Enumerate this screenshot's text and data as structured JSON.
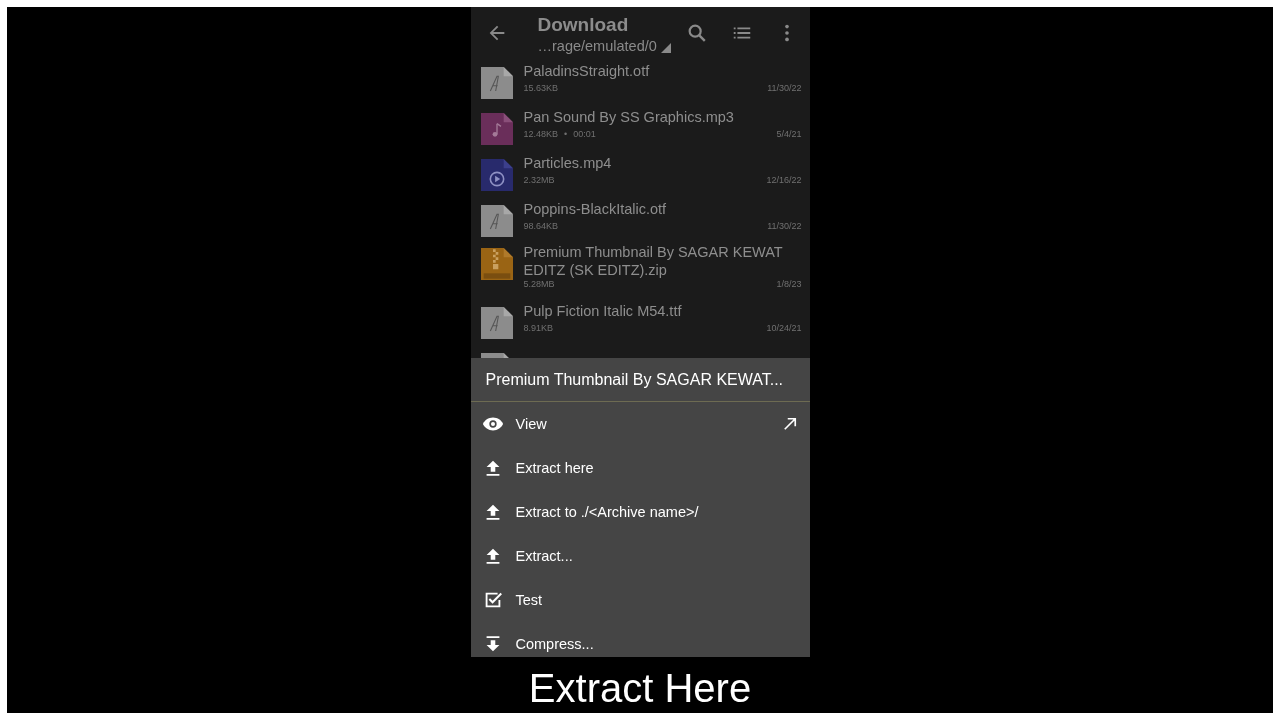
{
  "toolbar": {
    "title": "Download",
    "path": "…rage/emulated/0"
  },
  "files": [
    {
      "kind": "font",
      "name": "PaladinsStraight.otf",
      "size": "15.63KB",
      "date": "11/30/22"
    },
    {
      "kind": "audio",
      "name": "Pan Sound By SS Graphics.mp3",
      "size": "12.48KB",
      "separator": "•",
      "duration": "00:01",
      "date": "5/4/21"
    },
    {
      "kind": "video",
      "name": "Particles.mp4",
      "size": "2.32MB",
      "date": "12/16/22"
    },
    {
      "kind": "font",
      "name": "Poppins-BlackItalic.otf",
      "size": "98.64KB",
      "date": "11/30/22"
    },
    {
      "kind": "zip",
      "name": "Premium Thumbnail By SAGAR KEWAT EDITZ (SK EDITZ).zip",
      "size": "5.28MB",
      "date": "1/8/23"
    },
    {
      "kind": "font",
      "name": "Pulp Fiction Italic M54.ttf",
      "size": "8.91KB",
      "date": "10/24/21"
    },
    {
      "kind": "font"
    }
  ],
  "dialog": {
    "title": "Premium Thumbnail By SAGAR KEWAT...",
    "items": [
      {
        "kind": "view",
        "label": "View",
        "external": true
      },
      {
        "kind": "extract",
        "label": "Extract here"
      },
      {
        "kind": "extract",
        "label": "Extract to ./<Archive name>/"
      },
      {
        "kind": "extract",
        "label": "Extract..."
      },
      {
        "kind": "test",
        "label": "Test"
      },
      {
        "kind": "compress",
        "label": "Compress..."
      }
    ]
  },
  "caption": "Extract Here"
}
